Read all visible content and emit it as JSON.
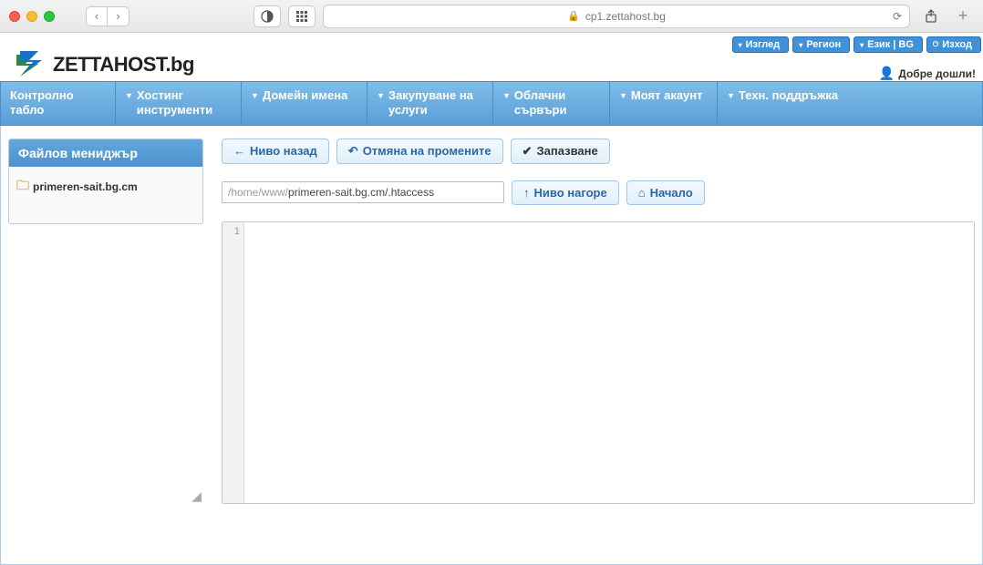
{
  "browser": {
    "url": "cp1.zettahost.bg"
  },
  "logo_text": "ZETTAHOST.bg",
  "top_buttons": {
    "view": "Изглед",
    "region": "Регион",
    "lang": "Език | BG",
    "exit": "Изход"
  },
  "welcome_text": "Добре дошли!",
  "nav": {
    "dashboard": "Контролно табло",
    "hosting": "Хостинг инструменти",
    "domains": "Домейн имена",
    "services": "Закупуване на услуги",
    "cloud": "Облачни сървъри",
    "account": "Моят акаунт",
    "support": "Техн. поддръжка"
  },
  "sidebar": {
    "title": "Файлов мениджър",
    "tree_item": "primeren-sait.bg.cm"
  },
  "toolbar": {
    "back": "Ниво назад",
    "revert": "Отмяна на промените",
    "save": "Запазване"
  },
  "path": {
    "prefix": "/home/www/",
    "tail": "primeren-sait.bg.cm/.htaccess"
  },
  "path_toolbar": {
    "up": "Ниво нагоре",
    "home": "Начало"
  },
  "editor": {
    "line1": "1",
    "content": ""
  }
}
